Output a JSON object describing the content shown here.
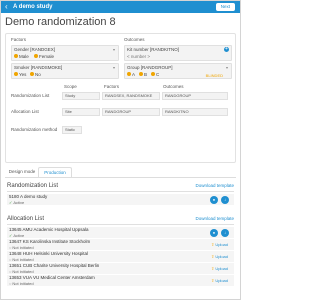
{
  "topbar": {
    "brand": "A demo study",
    "next_label": "Next"
  },
  "page": {
    "title": "Demo randomization 8"
  },
  "design": {
    "factors_label": "Factors",
    "outcomes_label": "Outcomes",
    "factors": [
      {
        "title": "Gender [RANDGEX]",
        "options": [
          "Male",
          "Female"
        ]
      },
      {
        "title": "Smoker [RANDSMOKE]",
        "options": [
          "Yes",
          "No"
        ]
      }
    ],
    "outcomes": [
      {
        "title": "Kit number [RANDKITNO]",
        "value": "< number >"
      },
      {
        "title": "Group [RANDGROUP]",
        "options": [
          "A",
          "B",
          "C"
        ],
        "tag": "BLINDED"
      }
    ],
    "table": {
      "headers": {
        "scope": "Scope",
        "factors": "Factors",
        "outcomes": "Outcomes"
      },
      "rows": [
        {
          "label": "Randomization List",
          "scope": "Study",
          "factors": "RANDSEX, RANDSMOKE",
          "outcomes": "RANDGROUP"
        },
        {
          "label": "Allocation List",
          "scope": "Site",
          "factors": "RANDGROUP",
          "outcomes": "RANDKITNO"
        }
      ],
      "method_label": "Randomization method",
      "method_value": "Static"
    }
  },
  "tabs": {
    "design": "Design mode",
    "production": "Production"
  },
  "randomization_list": {
    "title": "Randomization List",
    "download": "Download template",
    "items": [
      {
        "name": "5180 A demo study",
        "status": "Active"
      }
    ]
  },
  "allocation_list": {
    "title": "Allocation List",
    "download": "Download template",
    "upload_label": "Upload",
    "items": [
      {
        "name": "13645 AMU Academic Hospital Uppsala",
        "status": "Active"
      },
      {
        "name": "13647 KS Karolinska Institute Stockholm",
        "status": "Not initiated"
      },
      {
        "name": "13648 HUH Helsinki University Hospital",
        "status": "Not initiated"
      },
      {
        "name": "13651 CUB Charite University Hospital Berlin",
        "status": "Not initiated"
      },
      {
        "name": "13653 VUA VU Medical Center Amsterdam",
        "status": "Not initiated"
      }
    ]
  },
  "colors": {
    "accent": "#1f8fd0",
    "orange": "#f0a500",
    "active": "#3a9b3a"
  }
}
